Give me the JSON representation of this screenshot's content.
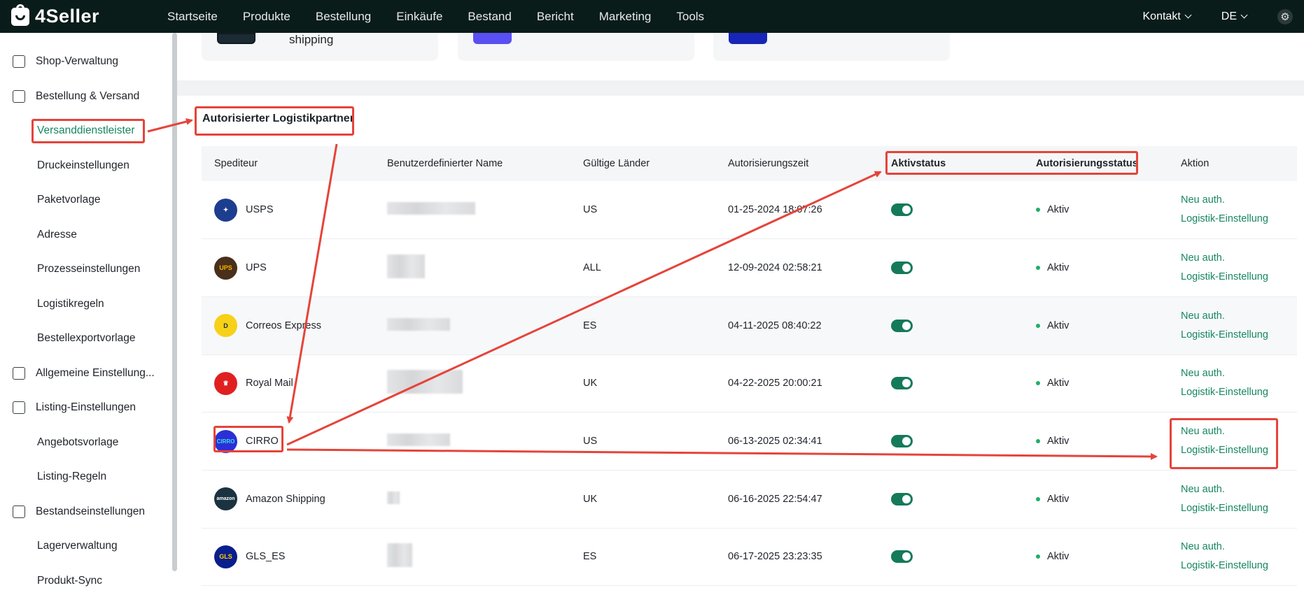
{
  "topnav": {
    "logo": "4Seller",
    "items": [
      "Startseite",
      "Produkte",
      "Bestellung",
      "Einkäufe",
      "Bestand",
      "Bericht",
      "Marketing",
      "Tools"
    ],
    "contact": "Kontakt",
    "language": "DE"
  },
  "sidebar": {
    "groups": [
      {
        "label": "Shop-Verwaltung",
        "icon": "shop-icon"
      },
      {
        "label": "Bestellung & Versand",
        "icon": "order-icon",
        "items": [
          "Versanddienstleister",
          "Druckeinstellungen",
          "Paketvorlage",
          "Adresse",
          "Prozesseinstellungen",
          "Logistikregeln",
          "Bestellexportvorlage"
        ]
      },
      {
        "label": "Allgemeine Einstellung...",
        "icon": "printer-icon"
      },
      {
        "label": "Listing-Einstellungen",
        "icon": "upload-icon",
        "items": [
          "Angebotsvorlage",
          "Listing-Regeln"
        ]
      },
      {
        "label": "Bestandseinstellungen",
        "icon": "inventory-icon",
        "items": [
          "Lagerverwaltung",
          "Produkt-Sync"
        ]
      }
    ],
    "active": "Versanddienstleister"
  },
  "cards": [
    {
      "text": "shipping"
    },
    {
      "text": ""
    },
    {
      "text": ""
    }
  ],
  "section_title": "Autorisierter Logistikpartner",
  "table": {
    "headers": [
      "Spediteur",
      "Benutzerdefinierter Name",
      "Gültige Länder",
      "Autorisierungszeit",
      "Aktivstatus",
      "Autorisierungsstatus",
      "Aktion"
    ],
    "rows": [
      {
        "carrier": "USPS",
        "countries": "US",
        "time": "01-25-2024 18:07:26",
        "status": "Aktiv"
      },
      {
        "carrier": "UPS",
        "countries": "ALL",
        "time": "12-09-2024 02:58:21",
        "status": "Aktiv"
      },
      {
        "carrier": "Correos Express",
        "countries": "ES",
        "time": "04-11-2025 08:40:22",
        "status": "Aktiv"
      },
      {
        "carrier": "Royal Mail",
        "countries": "UK",
        "time": "04-22-2025 20:00:21",
        "status": "Aktiv"
      },
      {
        "carrier": "CIRRO",
        "countries": "US",
        "time": "06-13-2025 02:34:41",
        "status": "Aktiv"
      },
      {
        "carrier": "Amazon Shipping",
        "countries": "UK",
        "time": "06-16-2025 22:54:47",
        "status": "Aktiv"
      },
      {
        "carrier": "GLS_ES",
        "countries": "ES",
        "time": "06-17-2025 23:23:35",
        "status": "Aktiv"
      }
    ],
    "action_reauth": "Neu auth.",
    "action_settings": "Logistik-Einstellung"
  },
  "colors": {
    "accent": "#17875f",
    "toggle": "#147a5a",
    "annotation": "#e5443a",
    "topnav": "#0a1c1a"
  }
}
